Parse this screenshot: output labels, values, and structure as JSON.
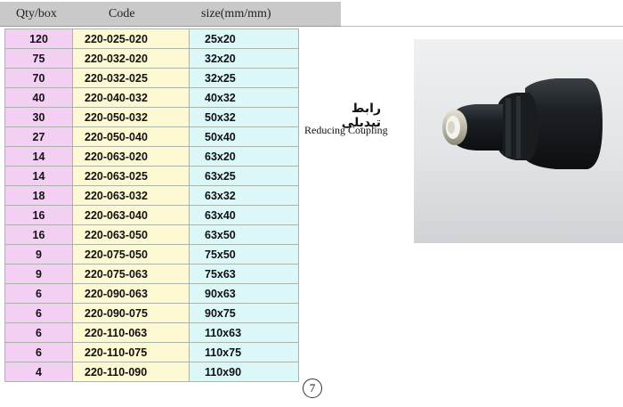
{
  "table": {
    "headers": {
      "qty": "Qty/box",
      "code": "Code",
      "size": "size(mm/mm)"
    },
    "rows": [
      {
        "qty": "120",
        "code": "220-025-020",
        "size": "25x20"
      },
      {
        "qty": "75",
        "code": "220-032-020",
        "size": "32x20"
      },
      {
        "qty": "70",
        "code": "220-032-025",
        "size": "32x25"
      },
      {
        "qty": "40",
        "code": "220-040-032",
        "size": "40x32"
      },
      {
        "qty": "30",
        "code": "220-050-032",
        "size": "50x32"
      },
      {
        "qty": "27",
        "code": "220-050-040",
        "size": "50x40"
      },
      {
        "qty": "14",
        "code": "220-063-020",
        "size": "63x20"
      },
      {
        "qty": "14",
        "code": "220-063-025",
        "size": "63x25"
      },
      {
        "qty": "18",
        "code": "220-063-032",
        "size": "63x32"
      },
      {
        "qty": "16",
        "code": "220-063-040",
        "size": "63x40"
      },
      {
        "qty": "16",
        "code": "220-063-050",
        "size": "63x50"
      },
      {
        "qty": "9",
        "code": "220-075-050",
        "size": "75x50"
      },
      {
        "qty": "9",
        "code": "220-075-063",
        "size": "75x63"
      },
      {
        "qty": "6",
        "code": "220-090-063",
        "size": "90x63"
      },
      {
        "qty": "6",
        "code": "220-090-075",
        "size": "90x75"
      },
      {
        "qty": "6",
        "code": "220-110-063",
        "size": "110x63"
      },
      {
        "qty": "6",
        "code": "220-110-075",
        "size": "110x75"
      },
      {
        "qty": "4",
        "code": "220-110-090",
        "size": "110x90"
      }
    ]
  },
  "product": {
    "name_fa": "رابط تبدیلی",
    "name_en": "Reducing Coupling",
    "image_icon": "reducing-coupling-photo"
  },
  "page_number": "7",
  "colors": {
    "header_bg": "#c9c9c9",
    "qty_bg": "#f3cff3",
    "code_bg": "#fdf9d3",
    "size_bg": "#dcf7f8"
  }
}
